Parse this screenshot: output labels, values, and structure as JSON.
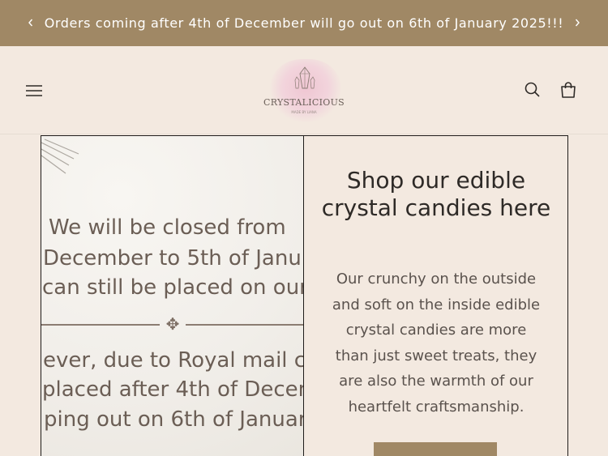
{
  "announcement": {
    "text": "Orders coming after 4th of December will go out on 6th of January 2025!!!",
    "prev_icon": "chevron-left-icon",
    "next_icon": "chevron-right-icon"
  },
  "header": {
    "menu_icon": "hamburger-menu-icon",
    "logo": {
      "name": "CRYSTALICIOUS",
      "tagline": "MADE BY LIANA"
    },
    "search_icon": "search-icon",
    "cart_icon": "shopping-bag-icon"
  },
  "feature": {
    "image_lines": [
      "We will be closed from",
      "December to 5th of Janu",
      "can still be placed on our",
      "ever, due to Royal mail clo",
      "placed after 4th of Decem",
      "ping out on 6th of Januar"
    ],
    "heading": "Shop our edible crystal candies here",
    "body": "Our crunchy on the outside and soft on the inside edible crystal candies are more than just sweet treats, they are also the warmth of our heartfelt craftsmanship.",
    "button_color": "#a08865"
  },
  "colors": {
    "announcement_bg": "#a08865",
    "page_bg": "#f3e9e0",
    "text": "#2e2a27"
  }
}
